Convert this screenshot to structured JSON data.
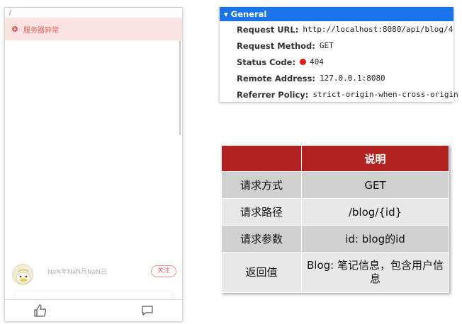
{
  "phone": {
    "error_text": "服务器异常",
    "date_text": "NaN年NaN月NaN日",
    "follow_label": "关注"
  },
  "general": {
    "header": "▾ General",
    "rows": [
      {
        "label": "Request URL:",
        "value": "http://localhost:8080/api/blog/4"
      },
      {
        "label": "Request Method:",
        "value": "GET"
      },
      {
        "label": "Status Code:",
        "value": "404"
      },
      {
        "label": "Remote Address:",
        "value": "127.0.0.1:8080"
      },
      {
        "label": "Referrer Policy:",
        "value": "strict-origin-when-cross-origin"
      }
    ],
    "status_color": "#e01b1b"
  },
  "table": {
    "header": [
      "",
      "说明"
    ],
    "rows": [
      [
        "请求方式",
        "GET"
      ],
      [
        "请求路径",
        "/blog/{id}"
      ],
      [
        "请求参数",
        "id: blog的id"
      ],
      [
        "返回值",
        "Blog: 笔记信息，包含用户信息"
      ]
    ]
  },
  "colors": {
    "accent": "#1a73e8",
    "table_header": "#b22222",
    "error_bg": "#fde2e2",
    "error_text": "#e35c5c"
  },
  "icons": [
    "error-icon",
    "like-icon",
    "comment-icon",
    "avatar"
  ]
}
